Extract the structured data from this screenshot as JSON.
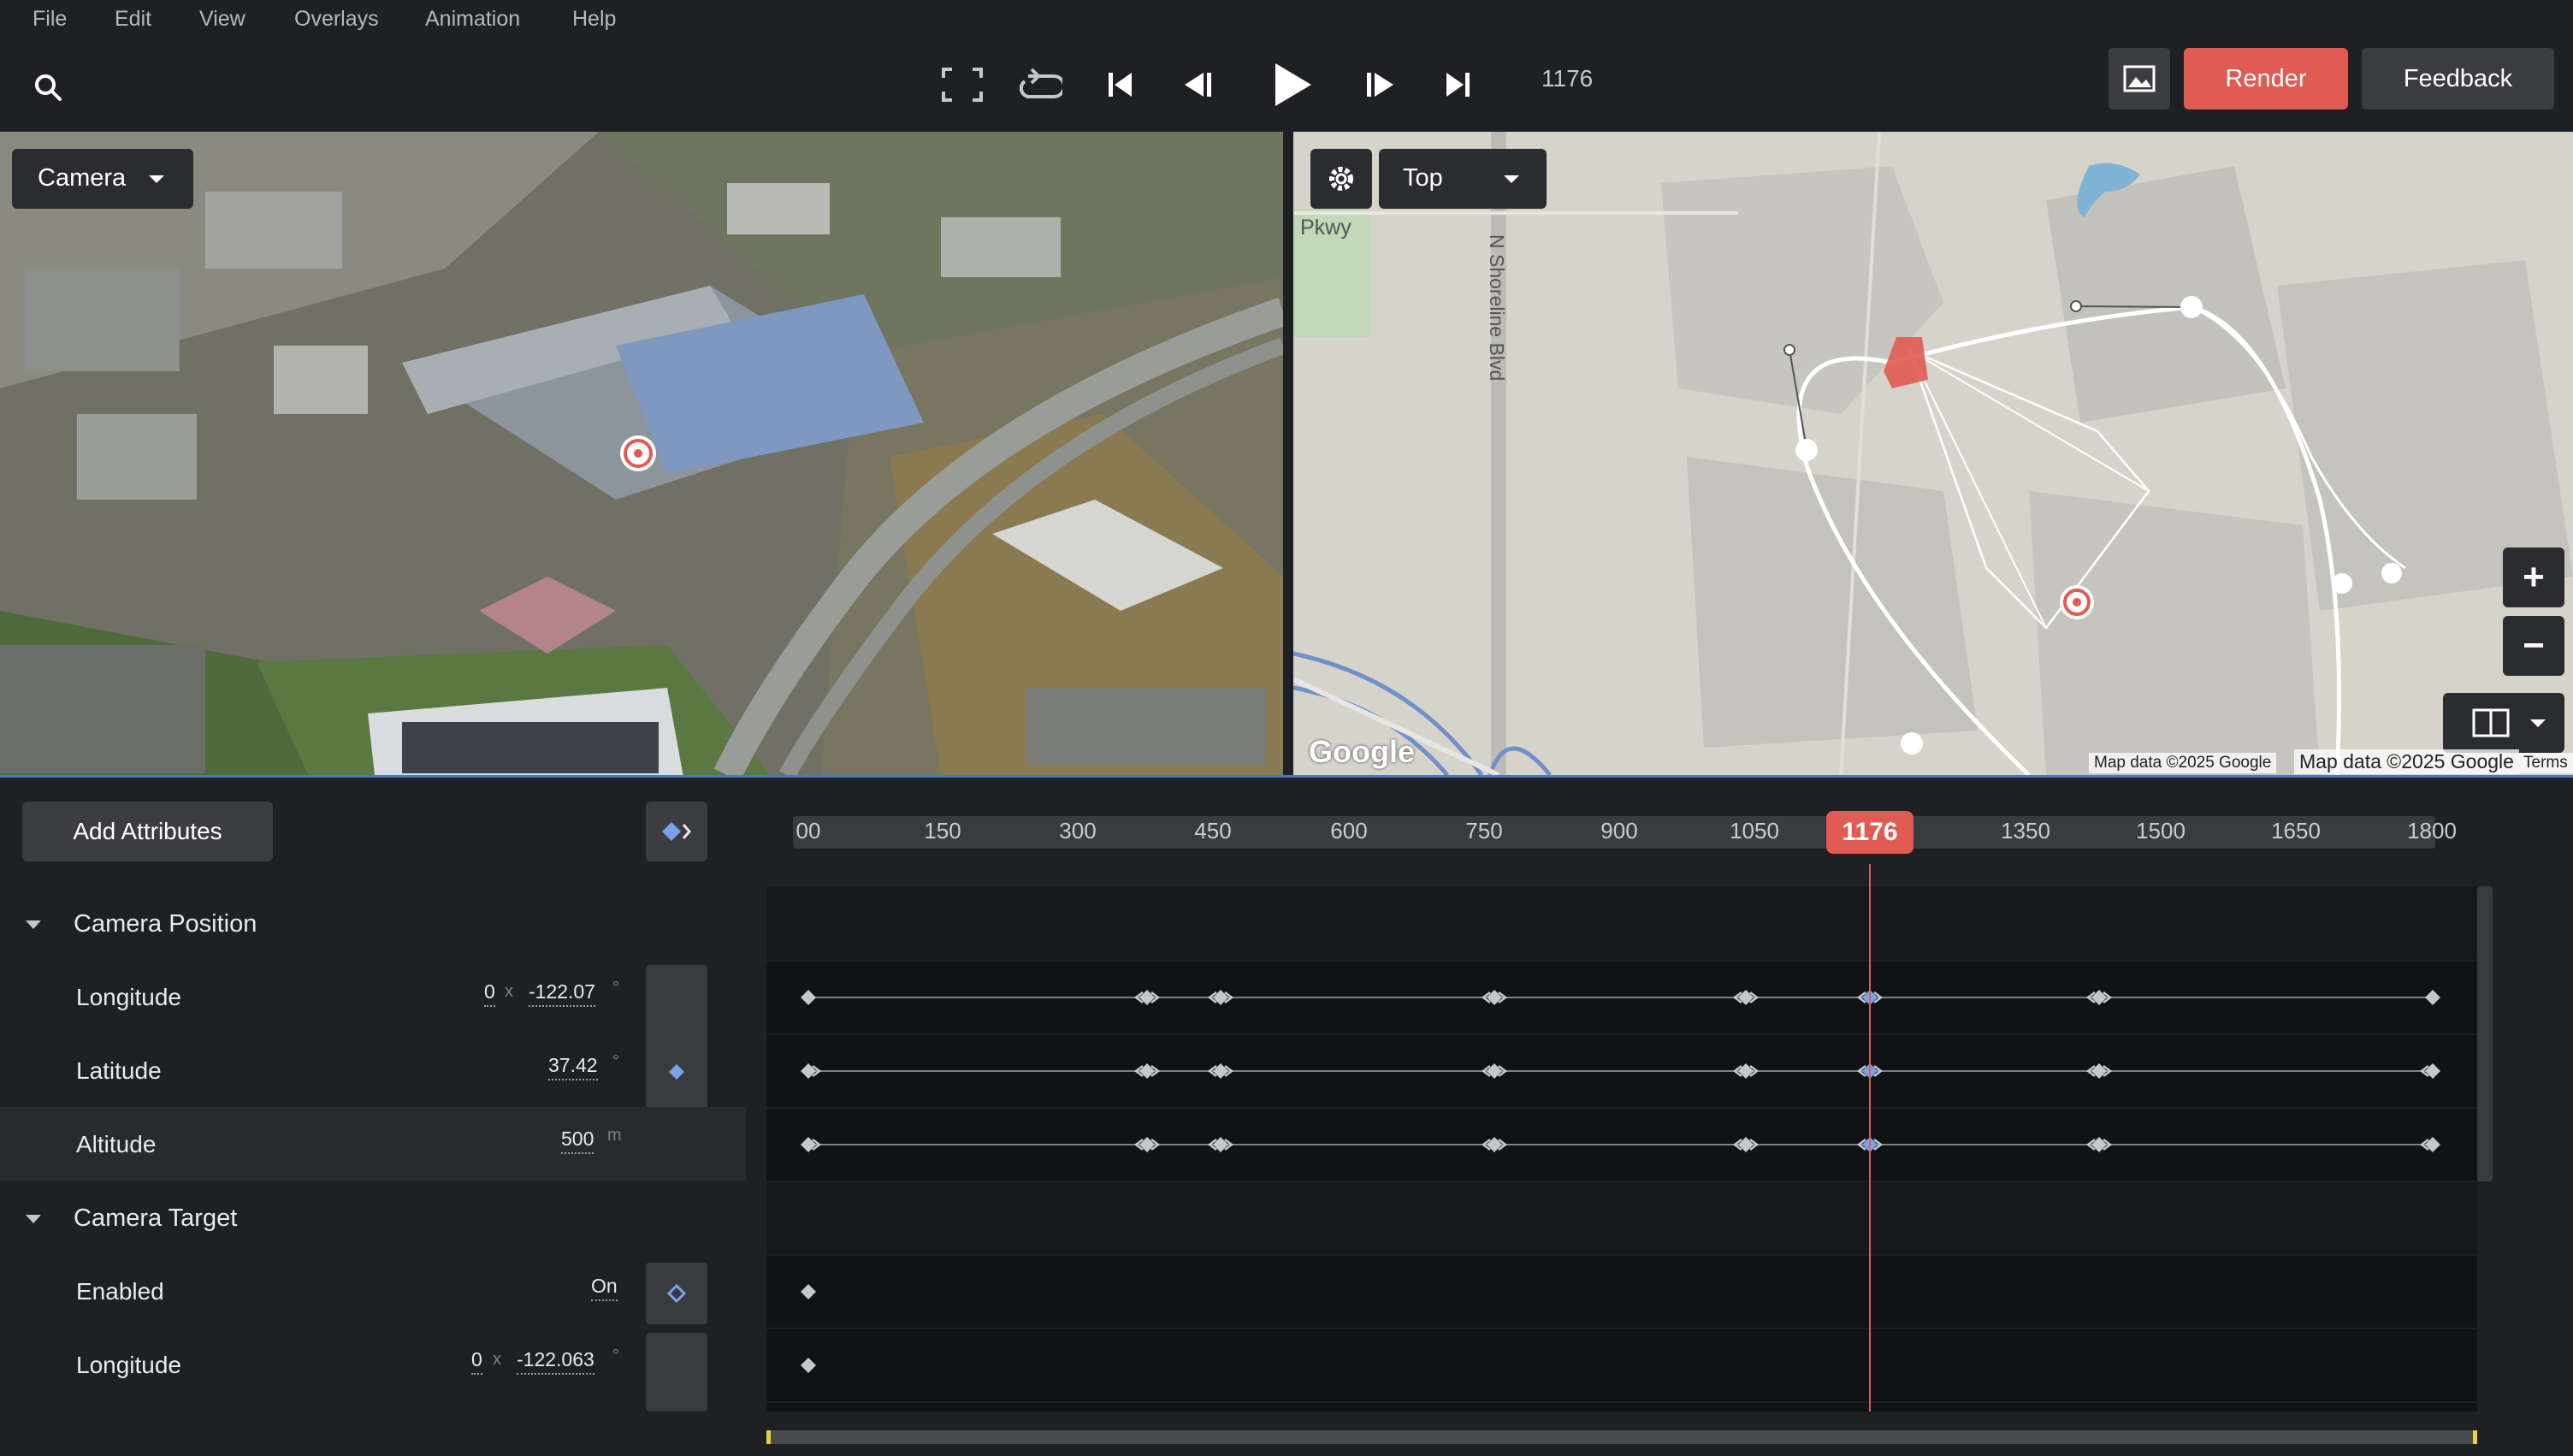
{
  "menu": {
    "items": [
      "File",
      "Edit",
      "View",
      "Overlays",
      "Animation",
      "Help"
    ]
  },
  "toolbar": {
    "frame_number": "1176",
    "render_label": "Render",
    "feedback_label": "Feedback"
  },
  "viewport_3d": {
    "mode_label": "Camera"
  },
  "viewport_map": {
    "view_label": "Top",
    "road_label": "N Shoreline Blvd",
    "parkway_label": "Pkwy",
    "google_logo": "Google",
    "attribution_1": "Map data ©2025 Google",
    "attribution_2": "Map data ©2025 Google",
    "terms": "Terms"
  },
  "timeline": {
    "add_attributes_label": "Add Attributes",
    "ticks": [
      "00",
      "150",
      "300",
      "450",
      "600",
      "750",
      "900",
      "1050",
      "1350",
      "1500",
      "1650",
      "1800"
    ],
    "playhead": "1176"
  },
  "properties": {
    "camera_position": {
      "title": "Camera Position",
      "longitude": {
        "label": "Longitude",
        "index": "0",
        "x": "x",
        "value": "-122.07",
        "unit": "°"
      },
      "latitude": {
        "label": "Latitude",
        "value": "37.42",
        "unit": "°"
      },
      "altitude": {
        "label": "Altitude",
        "value": "500",
        "unit": "m"
      }
    },
    "camera_target": {
      "title": "Camera Target",
      "enabled": {
        "label": "Enabled",
        "value": "On"
      },
      "longitude": {
        "label": "Longitude",
        "index": "0",
        "x": "x",
        "value": "-122.063",
        "unit": "°"
      }
    }
  },
  "colors": {
    "accent_red": "#e05b52",
    "keyframe_blue": "#7aa2e8",
    "panel_bg": "#1f2023"
  }
}
